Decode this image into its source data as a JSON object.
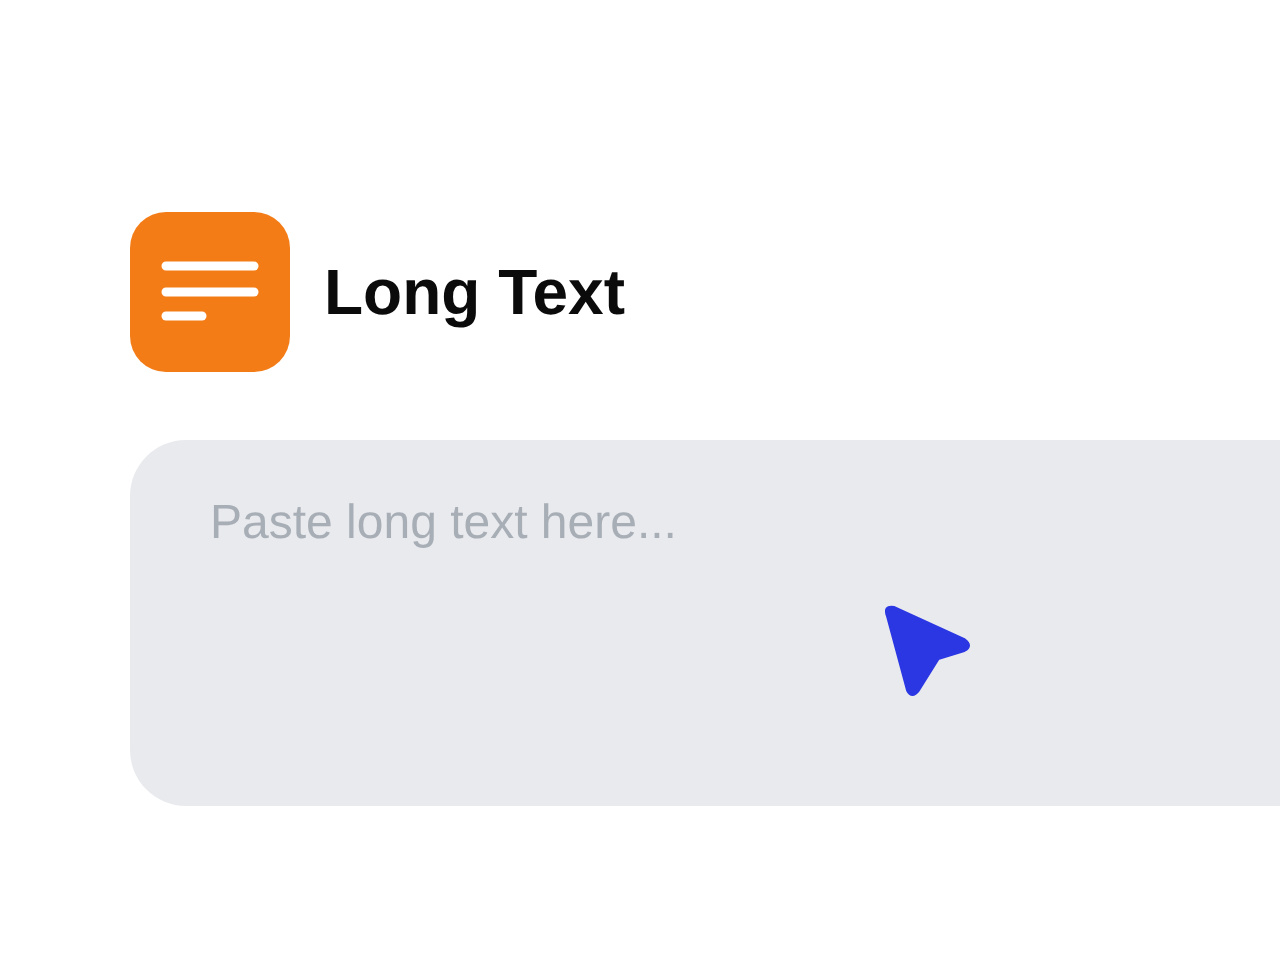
{
  "header": {
    "title": "Long Text"
  },
  "field": {
    "placeholder": "Paste long text here..."
  }
}
